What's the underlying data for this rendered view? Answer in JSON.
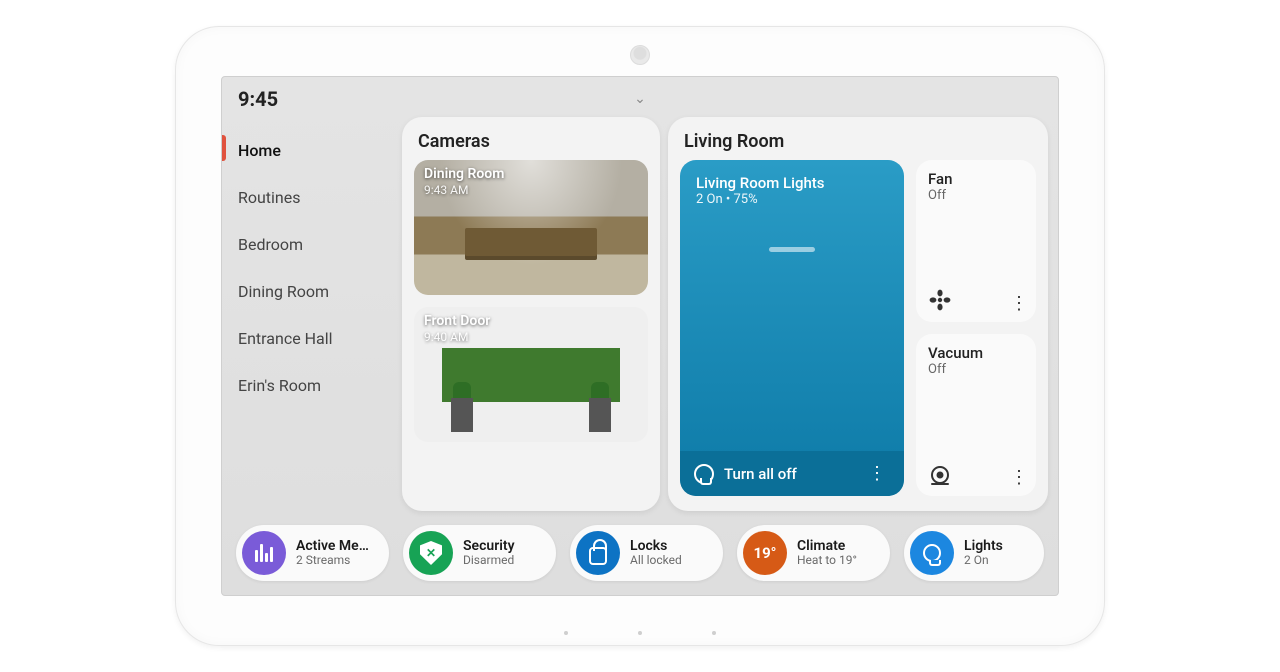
{
  "clock": "9:45",
  "sidebar": {
    "items": [
      {
        "label": "Home"
      },
      {
        "label": "Routines"
      },
      {
        "label": "Bedroom"
      },
      {
        "label": "Dining Room"
      },
      {
        "label": "Entrance Hall"
      },
      {
        "label": "Erin's Room"
      }
    ],
    "active_index": 0
  },
  "cameras": {
    "title": "Cameras",
    "items": [
      {
        "name": "Dining Room",
        "time": "9:43 AM"
      },
      {
        "name": "Front Door",
        "time": "9:40 AM"
      }
    ]
  },
  "living": {
    "title": "Living Room",
    "lights": {
      "title": "Living Room Lights",
      "status": "2 On • 75%",
      "action": "Turn all off"
    },
    "tiles": [
      {
        "title": "Fan",
        "status": "Off",
        "icon": "fan-icon"
      },
      {
        "title": "Vacuum",
        "status": "Off",
        "icon": "vacuum-icon"
      }
    ]
  },
  "pills": [
    {
      "title": "Active Media",
      "sub": "2 Streams",
      "icon": "equalizer-icon",
      "color": "ic-purple"
    },
    {
      "title": "Security",
      "sub": "Disarmed",
      "icon": "shield-icon",
      "color": "ic-green"
    },
    {
      "title": "Locks",
      "sub": "All locked",
      "icon": "lock-icon",
      "color": "ic-blue"
    },
    {
      "title": "Climate",
      "sub": "Heat to 19°",
      "icon": "thermostat-icon",
      "color": "ic-orange",
      "badge": "19°"
    },
    {
      "title": "Lights",
      "sub": "2 On",
      "icon": "bulb-icon",
      "color": "ic-blue2"
    }
  ]
}
